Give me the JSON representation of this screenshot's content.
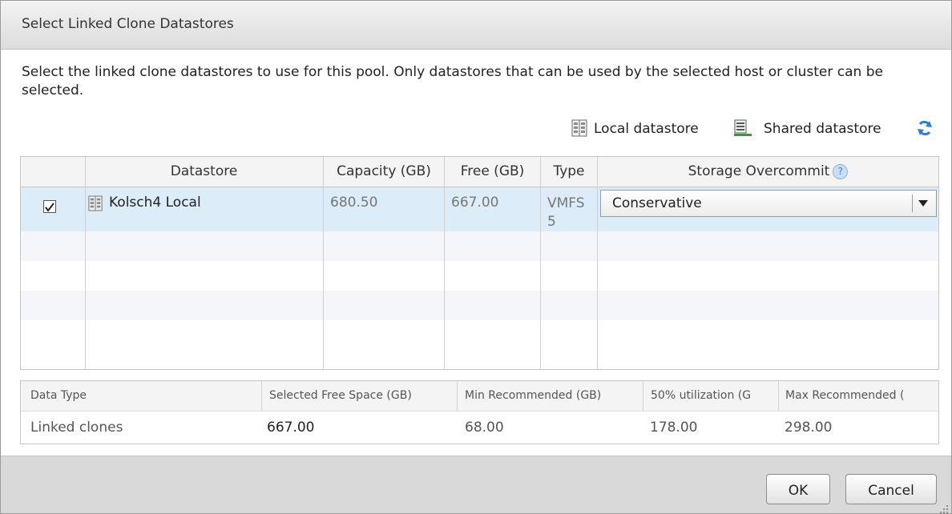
{
  "dialog": {
    "title": "Select Linked Clone Datastores",
    "description": "Select the linked clone datastores to use for this pool. Only datastores that can be used by the selected host or cluster can be selected."
  },
  "legend": {
    "local_label": "Local datastore",
    "local_icon": "local-datastore-icon",
    "shared_label": "Shared datastore",
    "shared_icon": "shared-datastore-icon",
    "refresh_icon": "refresh-icon"
  },
  "datastore_table": {
    "columns": [
      "Datastore",
      "Capacity (GB)",
      "Free (GB)",
      "Type",
      "Storage Overcommit"
    ],
    "help_icon_text": "?",
    "rows": [
      {
        "checked": true,
        "icon": "local-datastore-icon",
        "name": "Kolsch4 Local",
        "capacity": "680.50",
        "free": "667.00",
        "type_line1": "VMFS",
        "type_line2": "5",
        "overcommit": "Conservative"
      }
    ]
  },
  "summary_table": {
    "columns": [
      "Data Type",
      "Selected Free Space (GB)",
      "Min Recommended (GB)",
      "50% utilization (G",
      "Max Recommended ("
    ],
    "row": {
      "data_type": "Linked clones",
      "selected_free": "667.00",
      "min_recommended": "68.00",
      "utilization_50": "178.00",
      "max_recommended": "298.00"
    }
  },
  "buttons": {
    "ok": "OK",
    "cancel": "Cancel"
  },
  "colors": {
    "selected_row": "#dcecf8",
    "stripe": "#f4f6f9",
    "footer": "#d9d9d9"
  }
}
